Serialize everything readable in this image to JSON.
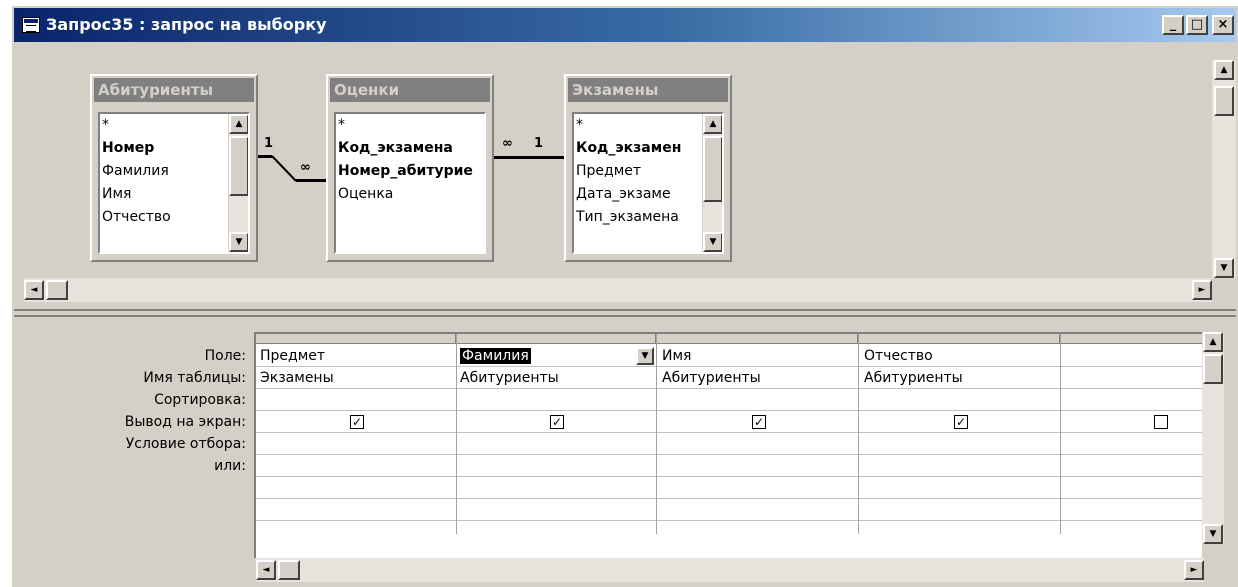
{
  "window": {
    "title": "Запрос35 : запрос на выборку",
    "controls": {
      "minimize": "_",
      "maximize": "□",
      "close": "×"
    }
  },
  "tables": [
    {
      "caption": "Абитуриенты",
      "fields": [
        {
          "name": "*",
          "key": false
        },
        {
          "name": "Номер",
          "key": true
        },
        {
          "name": "Фамилия",
          "key": false
        },
        {
          "name": "Имя",
          "key": false
        },
        {
          "name": "Отчество",
          "key": false
        }
      ]
    },
    {
      "caption": "Оценки",
      "fields": [
        {
          "name": "*",
          "key": false
        },
        {
          "name": "Код_экзамена",
          "key": true
        },
        {
          "name": "Номер_абитурие",
          "key": true
        },
        {
          "name": "Оценка",
          "key": false
        }
      ]
    },
    {
      "caption": "Экзамены",
      "fields": [
        {
          "name": "*",
          "key": false
        },
        {
          "name": "Код_экзамен",
          "key": true
        },
        {
          "name": "Предмет",
          "key": false
        },
        {
          "name": "Дата_экзаме",
          "key": false
        },
        {
          "name": "Тип_экзамена",
          "key": false
        }
      ]
    }
  ],
  "relationships": {
    "rel1_one": "1",
    "rel1_many": "∞",
    "rel2_many": "∞",
    "rel2_one": "1"
  },
  "grid": {
    "row_labels": {
      "field": "Поле:",
      "table": "Имя таблицы:",
      "sort": "Сортировка:",
      "show": "Вывод на экран:",
      "criteria": "Условие отбора:",
      "or": "или:"
    },
    "columns": [
      {
        "field": "Предмет",
        "table": "Экзамены",
        "show": true,
        "active": false
      },
      {
        "field": "Фамилия",
        "table": "Абитуриенты",
        "show": true,
        "active": true
      },
      {
        "field": "Имя",
        "table": "Абитуриенты",
        "show": true,
        "active": false
      },
      {
        "field": "Отчество",
        "table": "Абитуриенты",
        "show": true,
        "active": false
      },
      {
        "field": "",
        "table": "",
        "show": false,
        "active": false
      }
    ]
  },
  "icons": {
    "window": "query-window-icon",
    "scroll_up": "▲",
    "scroll_down": "▼",
    "scroll_left": "◄",
    "scroll_right": "►",
    "dropdown": "▼",
    "check": "✓"
  }
}
